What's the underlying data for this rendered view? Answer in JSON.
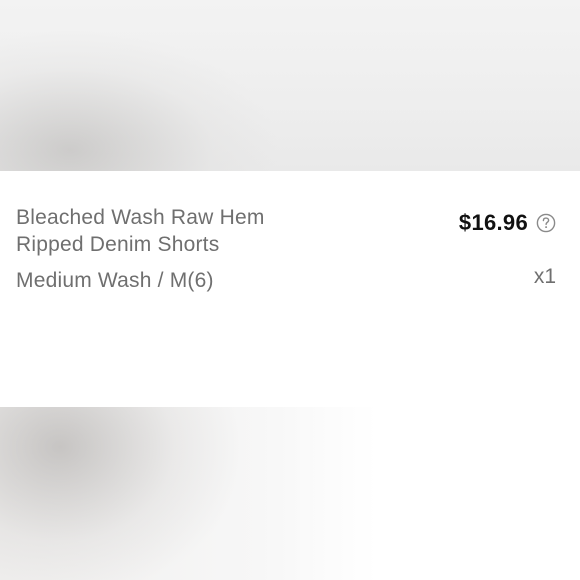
{
  "product": {
    "title_line1": "Bleached Wash Raw Hem",
    "title_line2": "Ripped Denim Shorts",
    "variant": "Medium Wash / M(6)",
    "price": "$16.96",
    "quantity": "x1",
    "help_icon": "question-circle-icon"
  },
  "colors": {
    "text_secondary": "#6f6f6f",
    "text_primary": "#111111",
    "background": "#ffffff"
  }
}
